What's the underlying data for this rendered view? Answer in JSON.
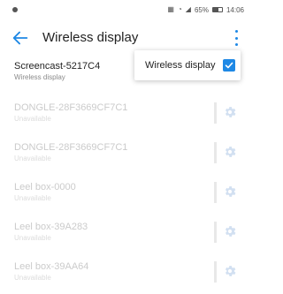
{
  "status_bar": {
    "battery_percent": "65%",
    "battery_level": 0.65,
    "time": "14:06",
    "icons": [
      "signal-icon",
      "wifi-icon",
      "mobile-signal-icon",
      "battery-icon"
    ]
  },
  "app_bar": {
    "title": "Wireless display",
    "back_icon": "back-arrow-icon",
    "menu_icon": "overflow-menu-icon"
  },
  "connected_device": {
    "name": "Screencast-5217C4",
    "status": "Wireless display"
  },
  "popup": {
    "label": "Wireless display",
    "checked": true
  },
  "devices": [
    {
      "name": "DONGLE-28F3669CF7C1",
      "status": "Unavailable"
    },
    {
      "name": "DONGLE-28F3669CF7C1",
      "status": "Unavailable"
    },
    {
      "name": "Leel box-0000",
      "status": "Unavailable"
    },
    {
      "name": "Leel box-39A283",
      "status": "Unavailable"
    },
    {
      "name": "Leel box-39AA64",
      "status": "Unavailable"
    }
  ],
  "colors": {
    "accent": "#1e88e5"
  }
}
